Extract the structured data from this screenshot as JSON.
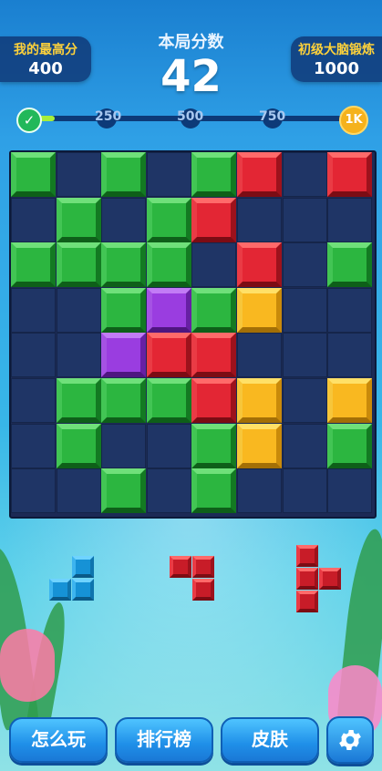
{
  "header": {
    "best_label": "我的最高分",
    "best_value": "400",
    "score_label": "本局分数",
    "score_value": "42",
    "level_label": "初级大脑锻炼",
    "level_value": "1000"
  },
  "progress": {
    "value_fraction": 0.04,
    "milestones": [
      "250",
      "500",
      "750"
    ],
    "goal": "1K"
  },
  "board": {
    "cols": 8,
    "rows": 8,
    "colors": {
      "G": "green",
      "R": "red",
      "Y": "yellow",
      "P": "purple"
    },
    "cells": [
      "G.G.GR.R",
      ".G.GR...",
      "GGGG.R.G",
      "..GPGY..",
      "..PRR...",
      ".GGGRY.Y",
      ".G..GY.G",
      "..G.G..."
    ]
  },
  "pieces": [
    {
      "color": "blue",
      "shape": [
        ".X",
        "XX"
      ]
    },
    {
      "color": "red",
      "shape": [
        "XX",
        ".X"
      ]
    },
    {
      "color": "red",
      "shape": [
        "X.",
        "XX",
        "X."
      ]
    }
  ],
  "buttons": {
    "how_to_play": "怎么玩",
    "leaderboard": "排行榜",
    "skins": "皮肤",
    "settings_icon": "gear-icon"
  }
}
